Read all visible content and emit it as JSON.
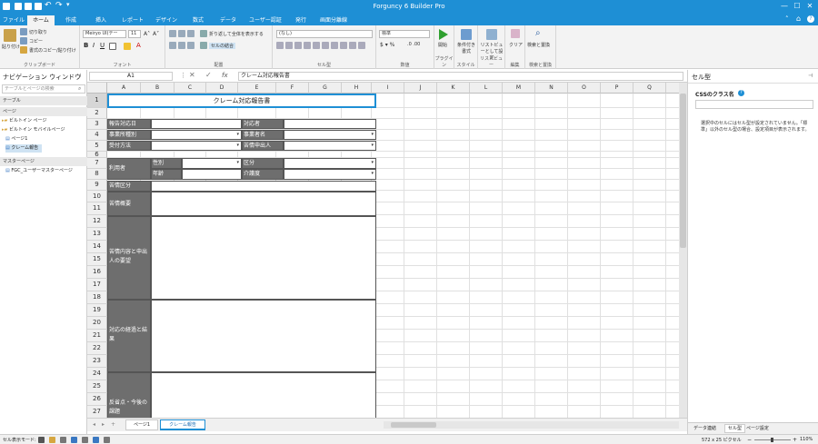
{
  "app": {
    "title": "Forguncy 6 Builder Pro"
  },
  "tabs": [
    "ファイル",
    "ホーム",
    "作成",
    "挿入",
    "レポート",
    "デザイン",
    "数式",
    "データ",
    "ユーザー認証",
    "発行",
    "画面分離線"
  ],
  "ribbon": {
    "clipboard": {
      "paste": "貼り付け",
      "cut": "切り取り",
      "copy": "コピー",
      "format_paste": "書式のコピー/貼り付け",
      "label": "クリップボード"
    },
    "font": {
      "name": "Meiryo UI(テー",
      "size": "11",
      "label": "フォント"
    },
    "align": {
      "wrap": "折り返して全体を表示する",
      "merge": "セルの結合",
      "label": "配置"
    },
    "celltype": {
      "value": "(なし)",
      "label": "セル型"
    },
    "number": {
      "value": "標準",
      "label": "数値"
    },
    "plugin": {
      "start": "開始",
      "label": "プラグイン"
    },
    "style": {
      "cond": "条件付き書式",
      "label": "スタイル"
    },
    "list": {
      "review": "リストビューとして設定",
      "label": "リストビュー"
    },
    "edit": {
      "clear": "クリア",
      "label": "編集"
    },
    "search": {
      "find": "検索と置換",
      "label": "検索と置換"
    }
  },
  "nav": {
    "title": "ナビゲーション ウィンドウ",
    "search_placeholder": "テーブルとページの検索",
    "sections": {
      "table": "テーブル",
      "page": "ページ",
      "master": "マスターページ"
    },
    "pages": [
      "ビルトイン ページ",
      "ビルトイン モバイルページ",
      "ページ1",
      "クレーム報告"
    ],
    "masters": [
      "FGC_ユーザーマスターページ"
    ]
  },
  "formula": {
    "cell_ref": "A1",
    "content": "クレーム対応報告書"
  },
  "columns": [
    "A",
    "B",
    "C",
    "D",
    "E",
    "F",
    "G",
    "H",
    "I",
    "J",
    "K",
    "L",
    "M",
    "N",
    "O",
    "P",
    "Q",
    "R"
  ],
  "rows": [
    "1",
    "2",
    "3",
    "4",
    "5",
    "6",
    "7",
    "8",
    "9",
    "10",
    "11",
    "12",
    "13",
    "14",
    "15",
    "16",
    "17",
    "18",
    "19",
    "20",
    "21",
    "22",
    "23",
    "24",
    "25",
    "26",
    "27",
    "28"
  ],
  "form": {
    "title": "クレーム対応報告書",
    "date": "報告対応日",
    "handler": "対応者",
    "business_type": "事業所種別",
    "business_name": "事業者名",
    "method": "受付方法",
    "reporter": "苦情申出人",
    "user": "利用者",
    "gender": "性別",
    "category": "区分",
    "age": "年齢",
    "care": "介護度",
    "complaint_type": "苦情区分",
    "summary": "苦情概要",
    "content": "苦情内容と申出人の要望",
    "process": "対応の経過と結果",
    "improve": "反省点・今後の課題"
  },
  "sheet_tabs": [
    "ページ1",
    "クレーム報告"
  ],
  "props": {
    "title": "セル型",
    "css_label": "CSSのクラス名",
    "message": "選択中のセルにはセル型が設定されていません。「標準」以外のセル型の場合、設定項目が表示されます。",
    "tabs": [
      "データ連結",
      "セル型",
      "ページ設定"
    ]
  },
  "status": {
    "mode": "セル表示モード:",
    "size": "572 x 25 ピクセル",
    "zoom": "110%"
  }
}
